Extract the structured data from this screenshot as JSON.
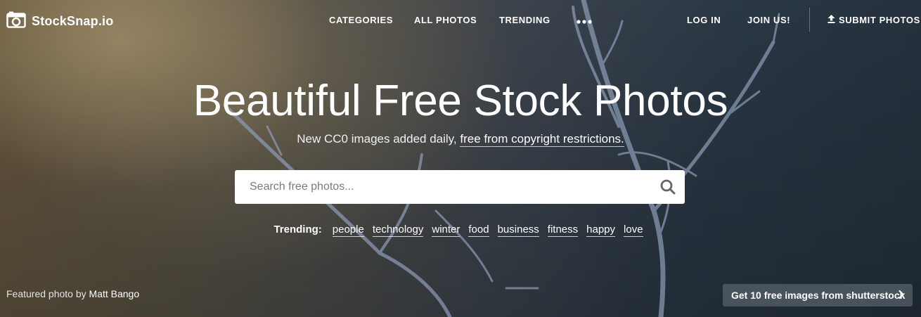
{
  "brand": {
    "name": "StockSnap.io",
    "logo_icon": "camera-icon"
  },
  "nav": {
    "categories": "CATEGORIES",
    "all_photos": "ALL PHOTOS",
    "trending": "TRENDING",
    "more_icon": "more-dots-icon",
    "log_in": "LOG IN",
    "join_us": "JOIN US!",
    "submit_photos": "SUBMIT PHOTOS",
    "submit_icon": "upload-icon"
  },
  "hero": {
    "title": "Beautiful Free Stock Photos",
    "subtitle_prefix": "New CC0 images added daily,",
    "subtitle_link": "free from copyright restrictions."
  },
  "search": {
    "placeholder": "Search free photos...",
    "value": "",
    "icon": "search-icon"
  },
  "trending": {
    "label": "Trending:",
    "tags": [
      "people",
      "technology",
      "winter",
      "food",
      "business",
      "fitness",
      "happy",
      "love"
    ]
  },
  "footer": {
    "credit_prefix": "Featured photo by",
    "credit_name": "Matt Bango",
    "promo_label": "Get 10 free images from shutterstock",
    "promo_icon": "chevron-right-icon"
  },
  "colors": {
    "text": "#ffffff",
    "search_bg": "#ffffff",
    "search_icon": "#666666",
    "promo_bg": "#505a64"
  }
}
